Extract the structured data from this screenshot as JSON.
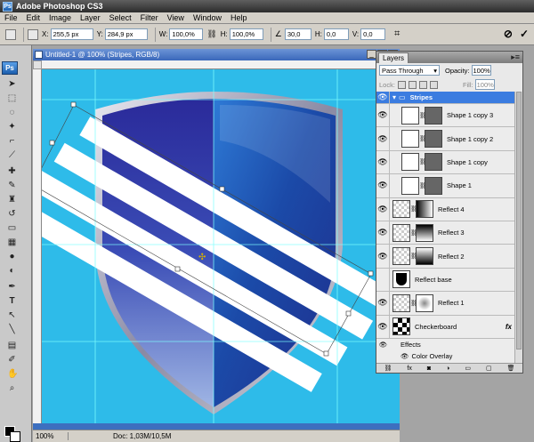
{
  "app": {
    "title": "Adobe Photoshop CS3",
    "logo_text": "Ps"
  },
  "menu": [
    "File",
    "Edit",
    "Image",
    "Layer",
    "Select",
    "Filter",
    "View",
    "Window",
    "Help"
  ],
  "options": {
    "x_label": "X:",
    "x_value": "255,5 px",
    "y_label": "Y:",
    "y_value": "284,9 px",
    "w_label": "W:",
    "w_value": "100,0%",
    "h_label": "H:",
    "h_value": "100,0%",
    "angle_value": "30,0",
    "hskew_label": "H:",
    "hskew_value": "0,0",
    "vskew_label": "V:",
    "vskew_value": "0,0",
    "cancel_icon": "cancel-transform-icon",
    "commit_icon": "commit-transform-icon"
  },
  "document": {
    "title": "Untitled-1 @ 100% (Stripes, RGB/8)",
    "zoom": "100%",
    "doc_size": "Doc: 1,03M/10,5M",
    "canvas_color": "#2ebbe9"
  },
  "layers_panel": {
    "tab": "Layers",
    "blend_mode": "Pass Through",
    "opacity_label": "Opacity:",
    "opacity_value": "100%",
    "lock_label": "Lock:",
    "fill_label": "Fill:",
    "fill_value": "100%",
    "layers": [
      {
        "name": "Stripes",
        "type": "group",
        "selected": true
      },
      {
        "name": "Shape 1 copy 3",
        "type": "shape"
      },
      {
        "name": "Shape 1 copy 2",
        "type": "shape"
      },
      {
        "name": "Shape 1 copy",
        "type": "shape"
      },
      {
        "name": "Shape 1",
        "type": "shape"
      },
      {
        "name": "Reflect 4",
        "type": "masked"
      },
      {
        "name": "Reflect 3",
        "type": "masked"
      },
      {
        "name": "Reflect 2",
        "type": "masked"
      },
      {
        "name": "Reflect base",
        "type": "plain"
      },
      {
        "name": "Reflect 1",
        "type": "masked"
      },
      {
        "name": "Checkerboard",
        "type": "fx"
      }
    ],
    "effects_label": "Effects",
    "color_overlay_label": "Color Overlay",
    "fx_label": "fx"
  }
}
